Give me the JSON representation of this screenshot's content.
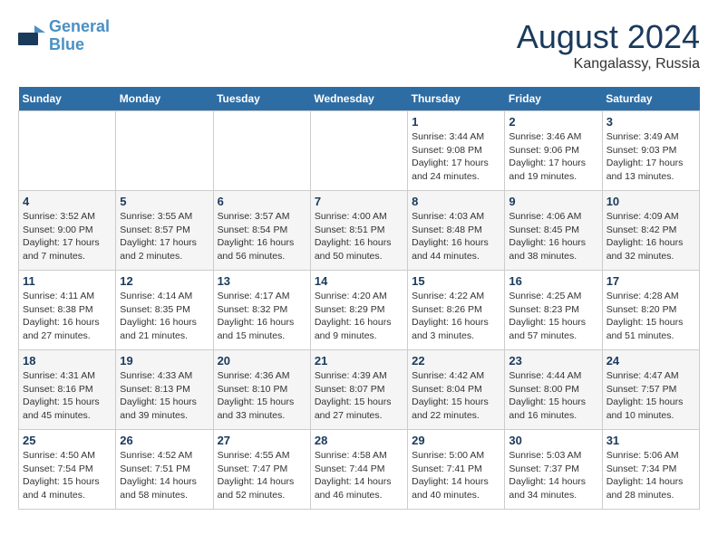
{
  "header": {
    "logo_line1": "General",
    "logo_line2": "Blue",
    "month_year": "August 2024",
    "location": "Kangalassy, Russia"
  },
  "weekdays": [
    "Sunday",
    "Monday",
    "Tuesday",
    "Wednesday",
    "Thursday",
    "Friday",
    "Saturday"
  ],
  "weeks": [
    [
      {
        "day": "",
        "info": ""
      },
      {
        "day": "",
        "info": ""
      },
      {
        "day": "",
        "info": ""
      },
      {
        "day": "",
        "info": ""
      },
      {
        "day": "1",
        "info": "Sunrise: 3:44 AM\nSunset: 9:08 PM\nDaylight: 17 hours\nand 24 minutes."
      },
      {
        "day": "2",
        "info": "Sunrise: 3:46 AM\nSunset: 9:06 PM\nDaylight: 17 hours\nand 19 minutes."
      },
      {
        "day": "3",
        "info": "Sunrise: 3:49 AM\nSunset: 9:03 PM\nDaylight: 17 hours\nand 13 minutes."
      }
    ],
    [
      {
        "day": "4",
        "info": "Sunrise: 3:52 AM\nSunset: 9:00 PM\nDaylight: 17 hours\nand 7 minutes."
      },
      {
        "day": "5",
        "info": "Sunrise: 3:55 AM\nSunset: 8:57 PM\nDaylight: 17 hours\nand 2 minutes."
      },
      {
        "day": "6",
        "info": "Sunrise: 3:57 AM\nSunset: 8:54 PM\nDaylight: 16 hours\nand 56 minutes."
      },
      {
        "day": "7",
        "info": "Sunrise: 4:00 AM\nSunset: 8:51 PM\nDaylight: 16 hours\nand 50 minutes."
      },
      {
        "day": "8",
        "info": "Sunrise: 4:03 AM\nSunset: 8:48 PM\nDaylight: 16 hours\nand 44 minutes."
      },
      {
        "day": "9",
        "info": "Sunrise: 4:06 AM\nSunset: 8:45 PM\nDaylight: 16 hours\nand 38 minutes."
      },
      {
        "day": "10",
        "info": "Sunrise: 4:09 AM\nSunset: 8:42 PM\nDaylight: 16 hours\nand 32 minutes."
      }
    ],
    [
      {
        "day": "11",
        "info": "Sunrise: 4:11 AM\nSunset: 8:38 PM\nDaylight: 16 hours\nand 27 minutes."
      },
      {
        "day": "12",
        "info": "Sunrise: 4:14 AM\nSunset: 8:35 PM\nDaylight: 16 hours\nand 21 minutes."
      },
      {
        "day": "13",
        "info": "Sunrise: 4:17 AM\nSunset: 8:32 PM\nDaylight: 16 hours\nand 15 minutes."
      },
      {
        "day": "14",
        "info": "Sunrise: 4:20 AM\nSunset: 8:29 PM\nDaylight: 16 hours\nand 9 minutes."
      },
      {
        "day": "15",
        "info": "Sunrise: 4:22 AM\nSunset: 8:26 PM\nDaylight: 16 hours\nand 3 minutes."
      },
      {
        "day": "16",
        "info": "Sunrise: 4:25 AM\nSunset: 8:23 PM\nDaylight: 15 hours\nand 57 minutes."
      },
      {
        "day": "17",
        "info": "Sunrise: 4:28 AM\nSunset: 8:20 PM\nDaylight: 15 hours\nand 51 minutes."
      }
    ],
    [
      {
        "day": "18",
        "info": "Sunrise: 4:31 AM\nSunset: 8:16 PM\nDaylight: 15 hours\nand 45 minutes."
      },
      {
        "day": "19",
        "info": "Sunrise: 4:33 AM\nSunset: 8:13 PM\nDaylight: 15 hours\nand 39 minutes."
      },
      {
        "day": "20",
        "info": "Sunrise: 4:36 AM\nSunset: 8:10 PM\nDaylight: 15 hours\nand 33 minutes."
      },
      {
        "day": "21",
        "info": "Sunrise: 4:39 AM\nSunset: 8:07 PM\nDaylight: 15 hours\nand 27 minutes."
      },
      {
        "day": "22",
        "info": "Sunrise: 4:42 AM\nSunset: 8:04 PM\nDaylight: 15 hours\nand 22 minutes."
      },
      {
        "day": "23",
        "info": "Sunrise: 4:44 AM\nSunset: 8:00 PM\nDaylight: 15 hours\nand 16 minutes."
      },
      {
        "day": "24",
        "info": "Sunrise: 4:47 AM\nSunset: 7:57 PM\nDaylight: 15 hours\nand 10 minutes."
      }
    ],
    [
      {
        "day": "25",
        "info": "Sunrise: 4:50 AM\nSunset: 7:54 PM\nDaylight: 15 hours\nand 4 minutes."
      },
      {
        "day": "26",
        "info": "Sunrise: 4:52 AM\nSunset: 7:51 PM\nDaylight: 14 hours\nand 58 minutes."
      },
      {
        "day": "27",
        "info": "Sunrise: 4:55 AM\nSunset: 7:47 PM\nDaylight: 14 hours\nand 52 minutes."
      },
      {
        "day": "28",
        "info": "Sunrise: 4:58 AM\nSunset: 7:44 PM\nDaylight: 14 hours\nand 46 minutes."
      },
      {
        "day": "29",
        "info": "Sunrise: 5:00 AM\nSunset: 7:41 PM\nDaylight: 14 hours\nand 40 minutes."
      },
      {
        "day": "30",
        "info": "Sunrise: 5:03 AM\nSunset: 7:37 PM\nDaylight: 14 hours\nand 34 minutes."
      },
      {
        "day": "31",
        "info": "Sunrise: 5:06 AM\nSunset: 7:34 PM\nDaylight: 14 hours\nand 28 minutes."
      }
    ]
  ]
}
